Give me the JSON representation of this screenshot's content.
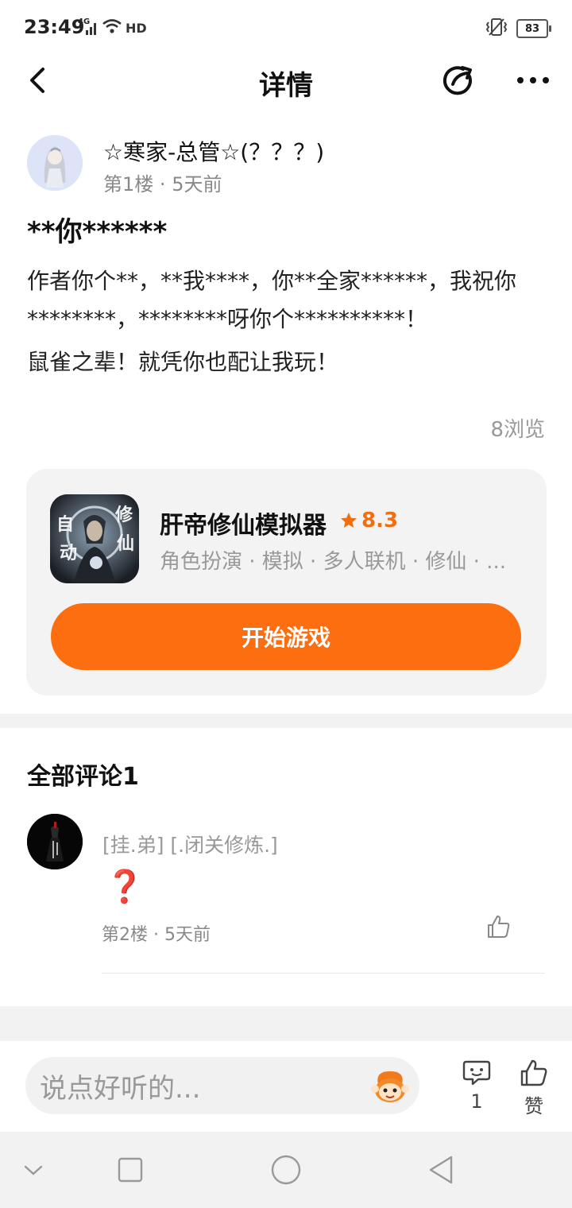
{
  "status_bar": {
    "time": "23:49",
    "network": "4G",
    "hd": "HD",
    "battery": "83"
  },
  "header": {
    "title": "详情"
  },
  "post": {
    "username": "☆寒家-总管☆(？？？)",
    "floor": "第1楼",
    "time_ago": "5天前",
    "title": "**你******",
    "paragraphs": [
      "作者你个**，**我****，你**全家******，我祝你********，********呀你个**********！",
      "鼠雀之辈！就凭你也配让我玩！"
    ],
    "views": "8浏览"
  },
  "game": {
    "icon_chars": [
      "自",
      "动",
      "修",
      "仙"
    ],
    "name": "肝帝修仙模拟器",
    "rating": "8.3",
    "tags": "角色扮演 · 模拟 · 多人联机 · 修仙 · ...",
    "play_label": "开始游戏"
  },
  "comments": {
    "heading": "全部评论1",
    "items": [
      {
        "user": "[挂.弟] [.闭关修炼.]",
        "body": "❓",
        "floor": "第2楼",
        "time_ago": "5天前"
      }
    ]
  },
  "input_bar": {
    "placeholder": "说点好听的...",
    "comment_count": "1",
    "like_label": "赞"
  },
  "colors": {
    "accent": "#fd6e10",
    "rating": "#f26d0f"
  }
}
